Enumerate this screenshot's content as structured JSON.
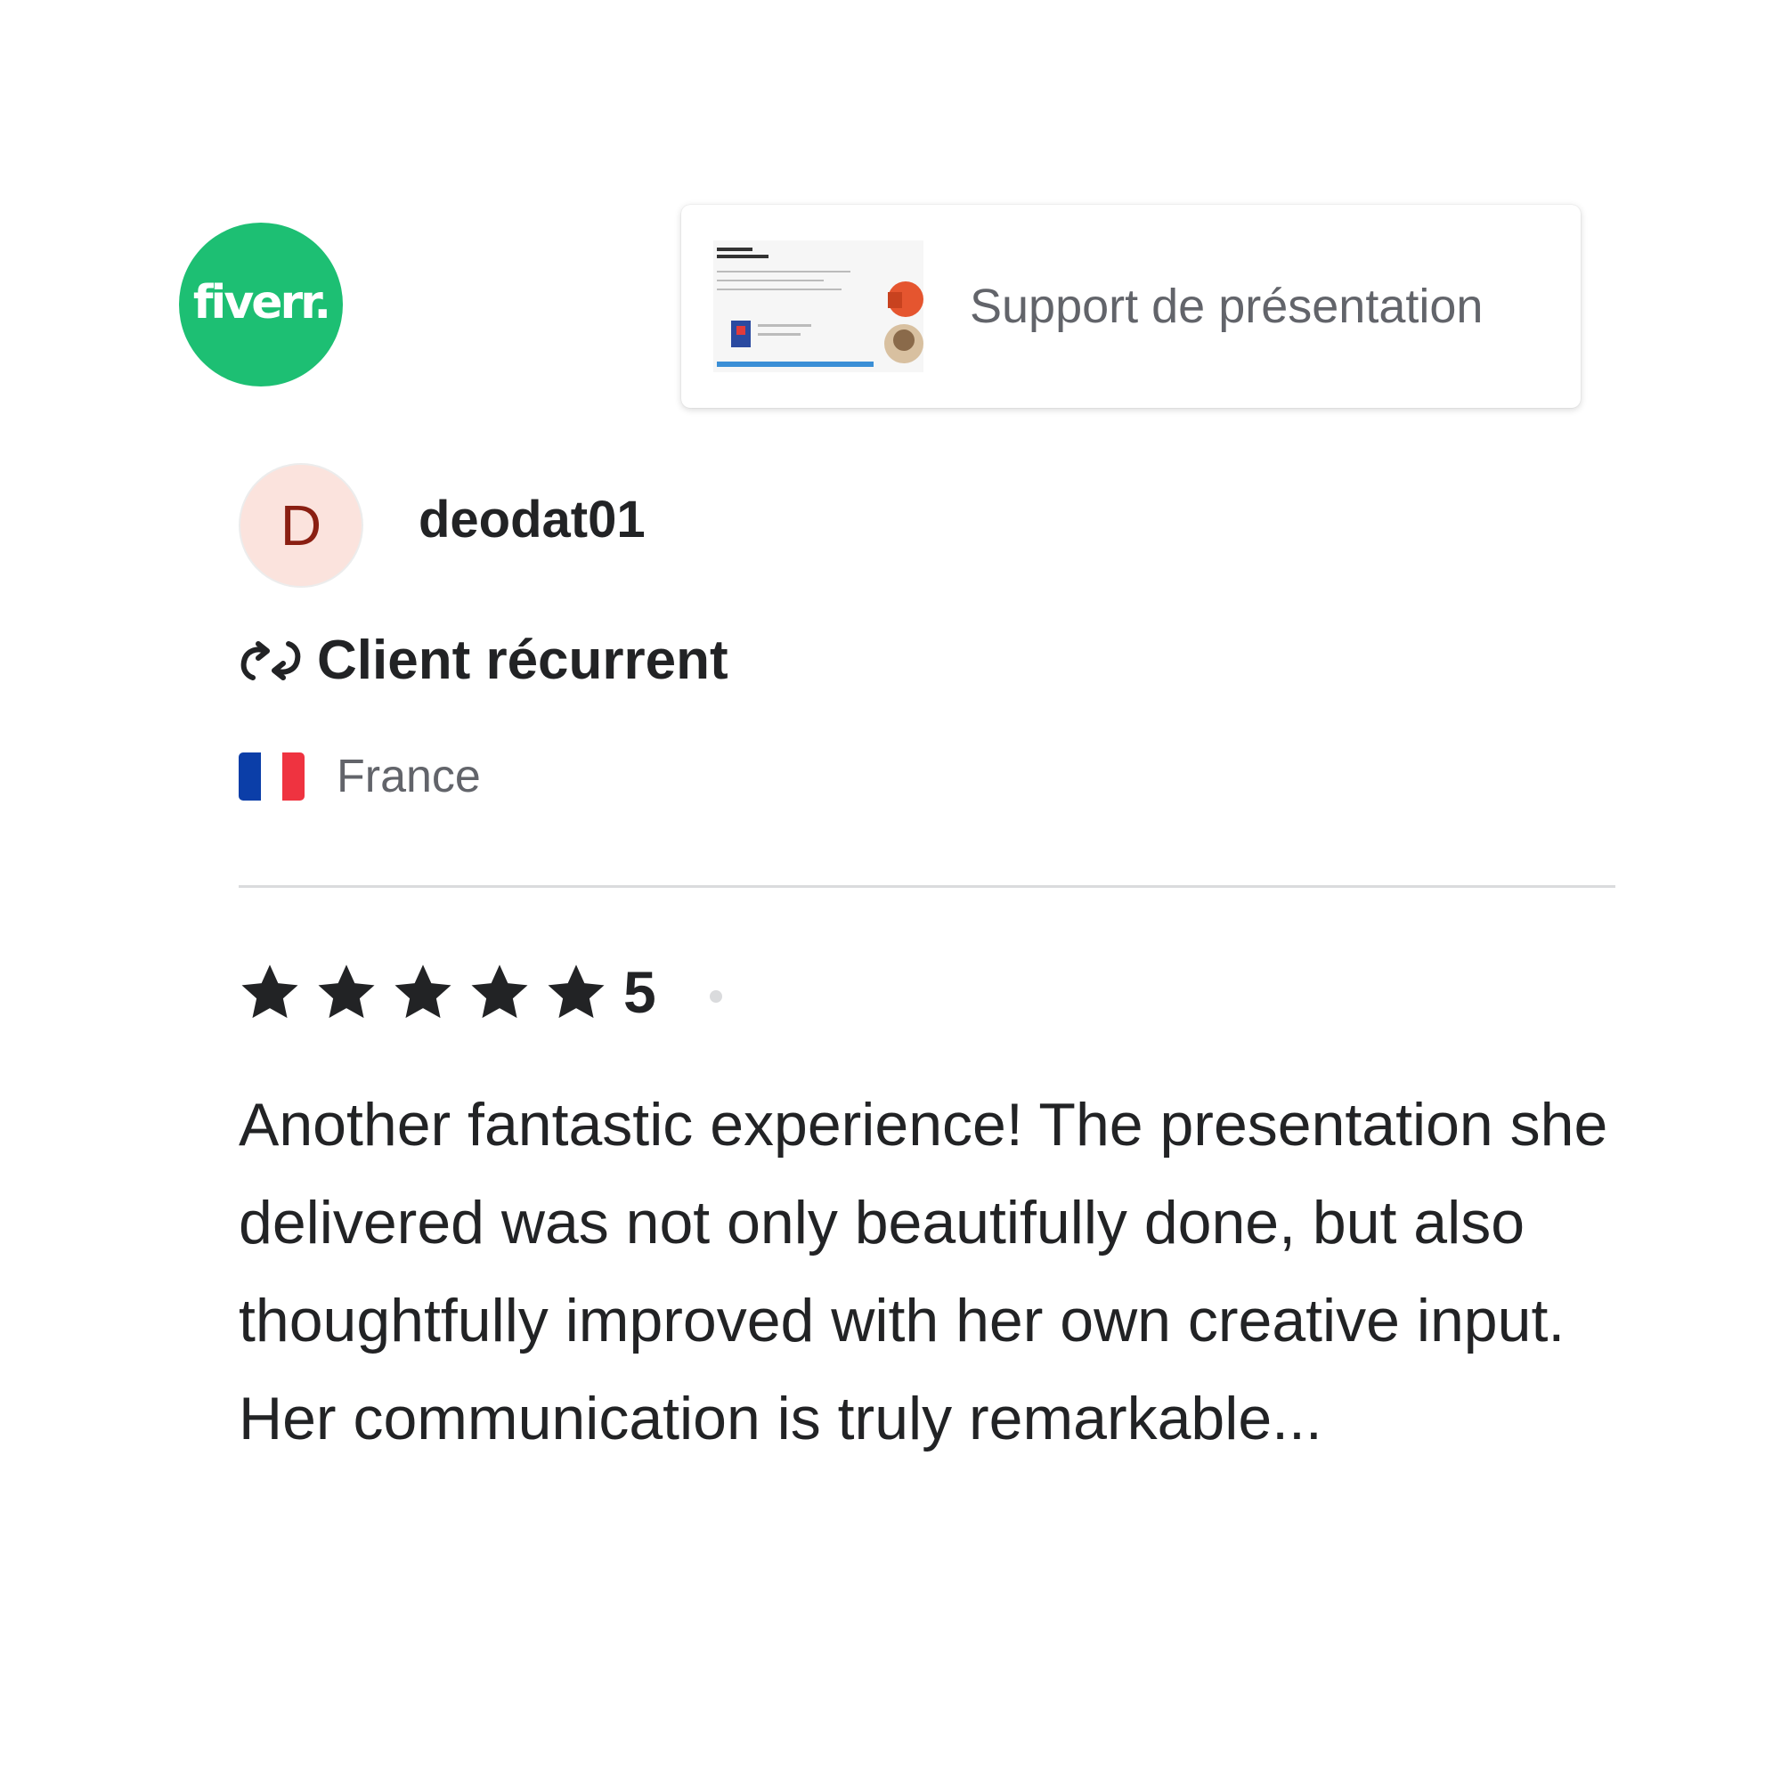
{
  "brand": {
    "logo_text": "fiverr.",
    "color": "#1dbf73"
  },
  "gig": {
    "title": "Support de présentation",
    "thumbnail_icon": "powerpoint-presentation-thumbnail"
  },
  "reviewer": {
    "avatar_letter": "D",
    "avatar_bg": "#fbe3dd",
    "username": "deodat01",
    "repeat_icon": "repeat-arrows-icon",
    "repeat_label": "Client récurrent",
    "country": "France",
    "flag_colors": [
      "#0b3ea8",
      "#ffffff",
      "#ef3340"
    ]
  },
  "review": {
    "rating": "5",
    "stars_filled": 5,
    "stars_total": 5,
    "text": "Another fantastic experience! The presentation she delivered was not only beautifully done, but also thoughtfully improved with her own creative input. Her communication is truly remarkable..."
  }
}
